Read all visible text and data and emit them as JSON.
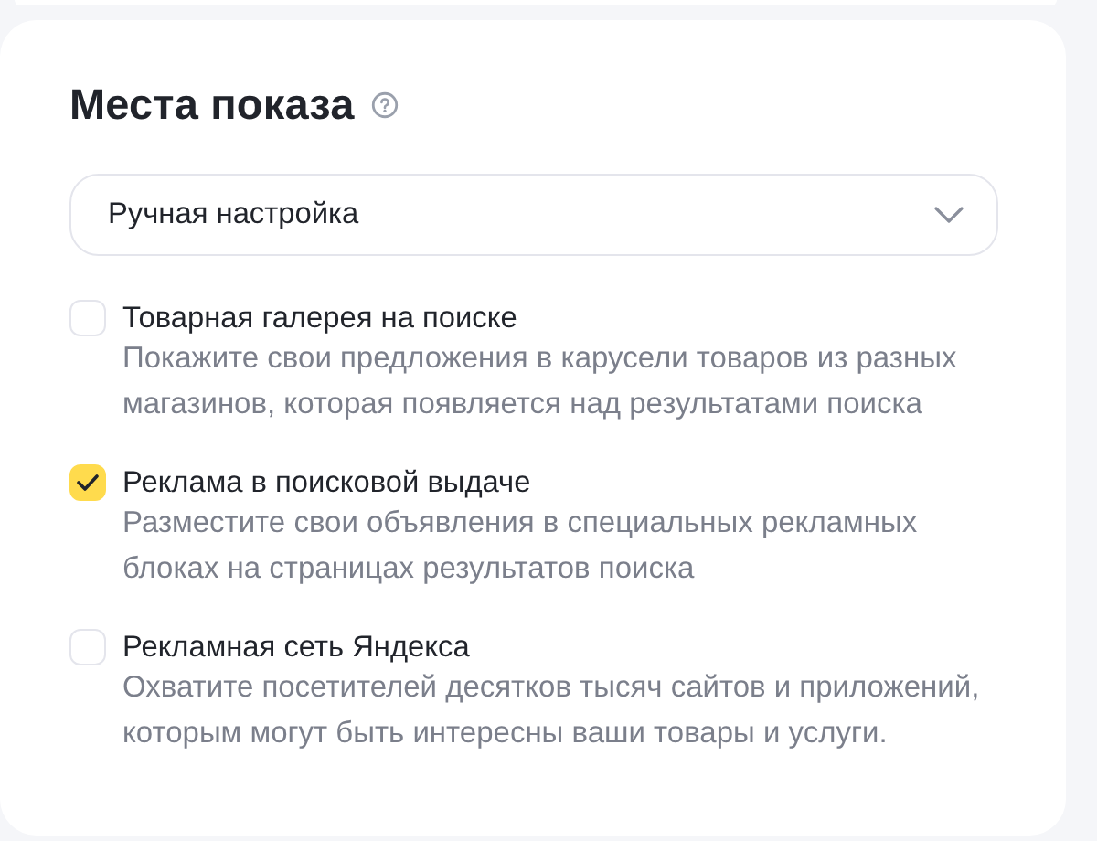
{
  "section": {
    "title": "Места показа",
    "dropdown": {
      "value": "Ручная настройка"
    },
    "options": [
      {
        "label": "Товарная галерея на поиске",
        "description": "Покажите свои предложения в карусели товаров из разных магазинов, которая появляется над результатами поиска",
        "checked": false
      },
      {
        "label": "Реклама в поисковой выдаче",
        "description": "Разместите свои объявления в специальных рекламных блоках на страницах результатов поиска",
        "checked": true
      },
      {
        "label": "Рекламная сеть Яндекса",
        "description": "Охватите посетителей десятков тысяч сайтов и приложений, которым могут быть интересны ваши товары и услуги.",
        "checked": false
      }
    ]
  }
}
